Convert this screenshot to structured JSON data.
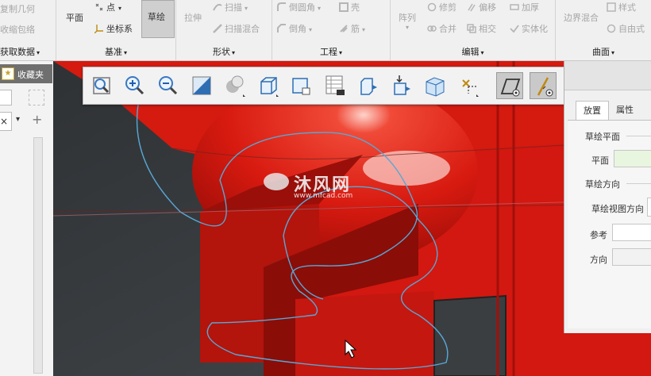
{
  "ribbon": {
    "g_getdata": {
      "label": "获取数据",
      "items": [
        "复制几何",
        "收缩包络"
      ]
    },
    "g_datum": {
      "label": "基准",
      "plane": "平面",
      "point": "点",
      "csys": "坐标系",
      "sketch": "草绘"
    },
    "g_shapes": {
      "label": "形状",
      "extrude": "拉伸",
      "sweep": "扫描",
      "sweep_blend": "扫描混合"
    },
    "g_engineering": {
      "label": "工程",
      "round": "倒圆角",
      "shell": "壳",
      "chamfer": "倒角",
      "rib": "筋"
    },
    "g_editing": {
      "label": "编辑",
      "pattern": "阵列",
      "trim": "修剪",
      "offset": "偏移",
      "thicken": "加厚",
      "merge": "合并",
      "intersect": "相交",
      "solidify": "实体化"
    },
    "g_surfaces": {
      "label": "曲面",
      "boundary_blend": "边界混合",
      "style": "样式",
      "freestyle": "自由式"
    }
  },
  "left_panel": {
    "favorites": "收藏夹"
  },
  "view_toolbar": {
    "buttons": [
      "refit",
      "zoom-in",
      "zoom-out",
      "repaint",
      "display-style",
      "saved-orientations",
      "view-manager",
      "appearance-gallery",
      "section",
      "perspective",
      "datum-display",
      "spin-center",
      "sketch-view",
      "annotation-display"
    ]
  },
  "sketch_dialog": {
    "tabs": [
      "放置",
      "属性"
    ],
    "section_plane": "草绘平面",
    "plane_label": "平面",
    "section_orientation": "草绘方向",
    "view_dir_label": "草绘视图方向",
    "reference_label": "参考",
    "direction_label": "方向"
  },
  "watermark": {
    "cn": "沐风网",
    "url": "www.mfcad.com"
  },
  "colors": {
    "accent_red": "#d81a10",
    "dark_red": "#8e0d08",
    "sketch_blue": "#57a8d6",
    "bg_dark": "#3a3d40"
  }
}
